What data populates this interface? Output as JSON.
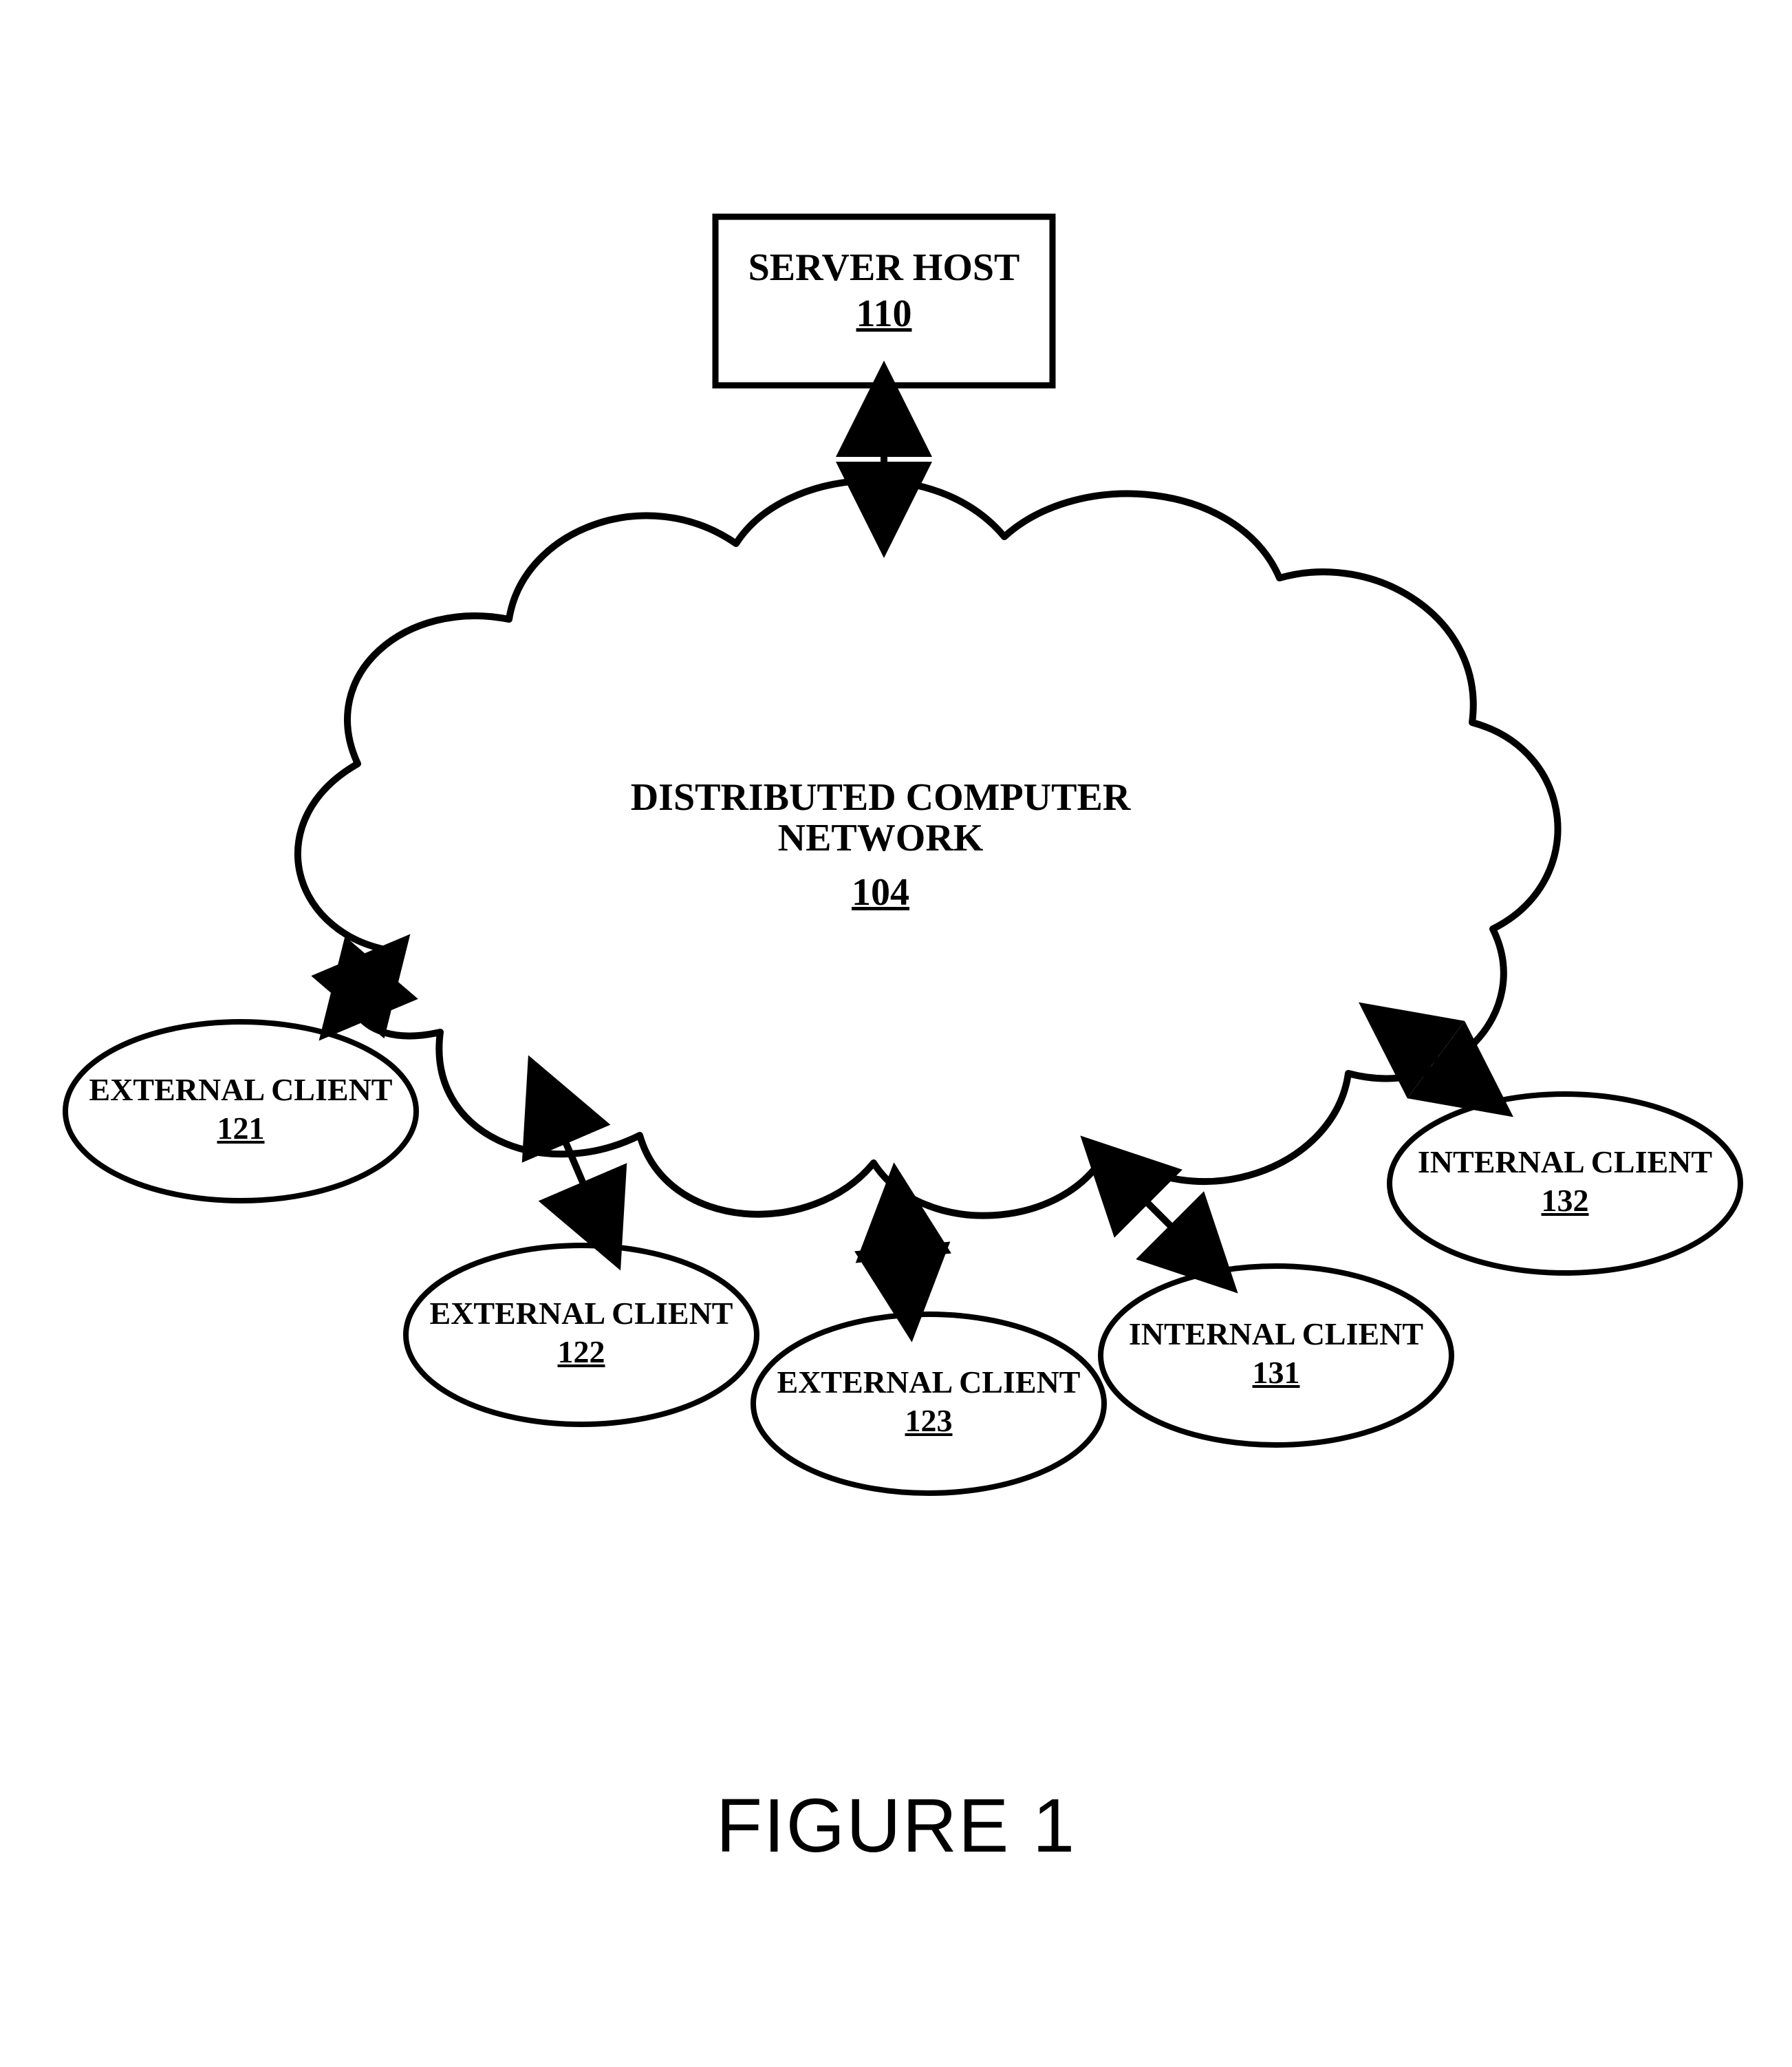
{
  "figure": {
    "caption": "FIGURE 1"
  },
  "server": {
    "title": "SERVER HOST",
    "ref": "110"
  },
  "network": {
    "title1": "DISTRIBUTED COMPUTER",
    "title2": "NETWORK",
    "ref": "104"
  },
  "clients": {
    "ext121": {
      "title": "EXTERNAL CLIENT",
      "ref": "121"
    },
    "ext122": {
      "title": "EXTERNAL CLIENT",
      "ref": "122"
    },
    "ext123": {
      "title": "EXTERNAL CLIENT",
      "ref": "123"
    },
    "int131": {
      "title": "INTERNAL CLIENT",
      "ref": "131"
    },
    "int132": {
      "title": "INTERNAL CLIENT",
      "ref": "132"
    }
  }
}
